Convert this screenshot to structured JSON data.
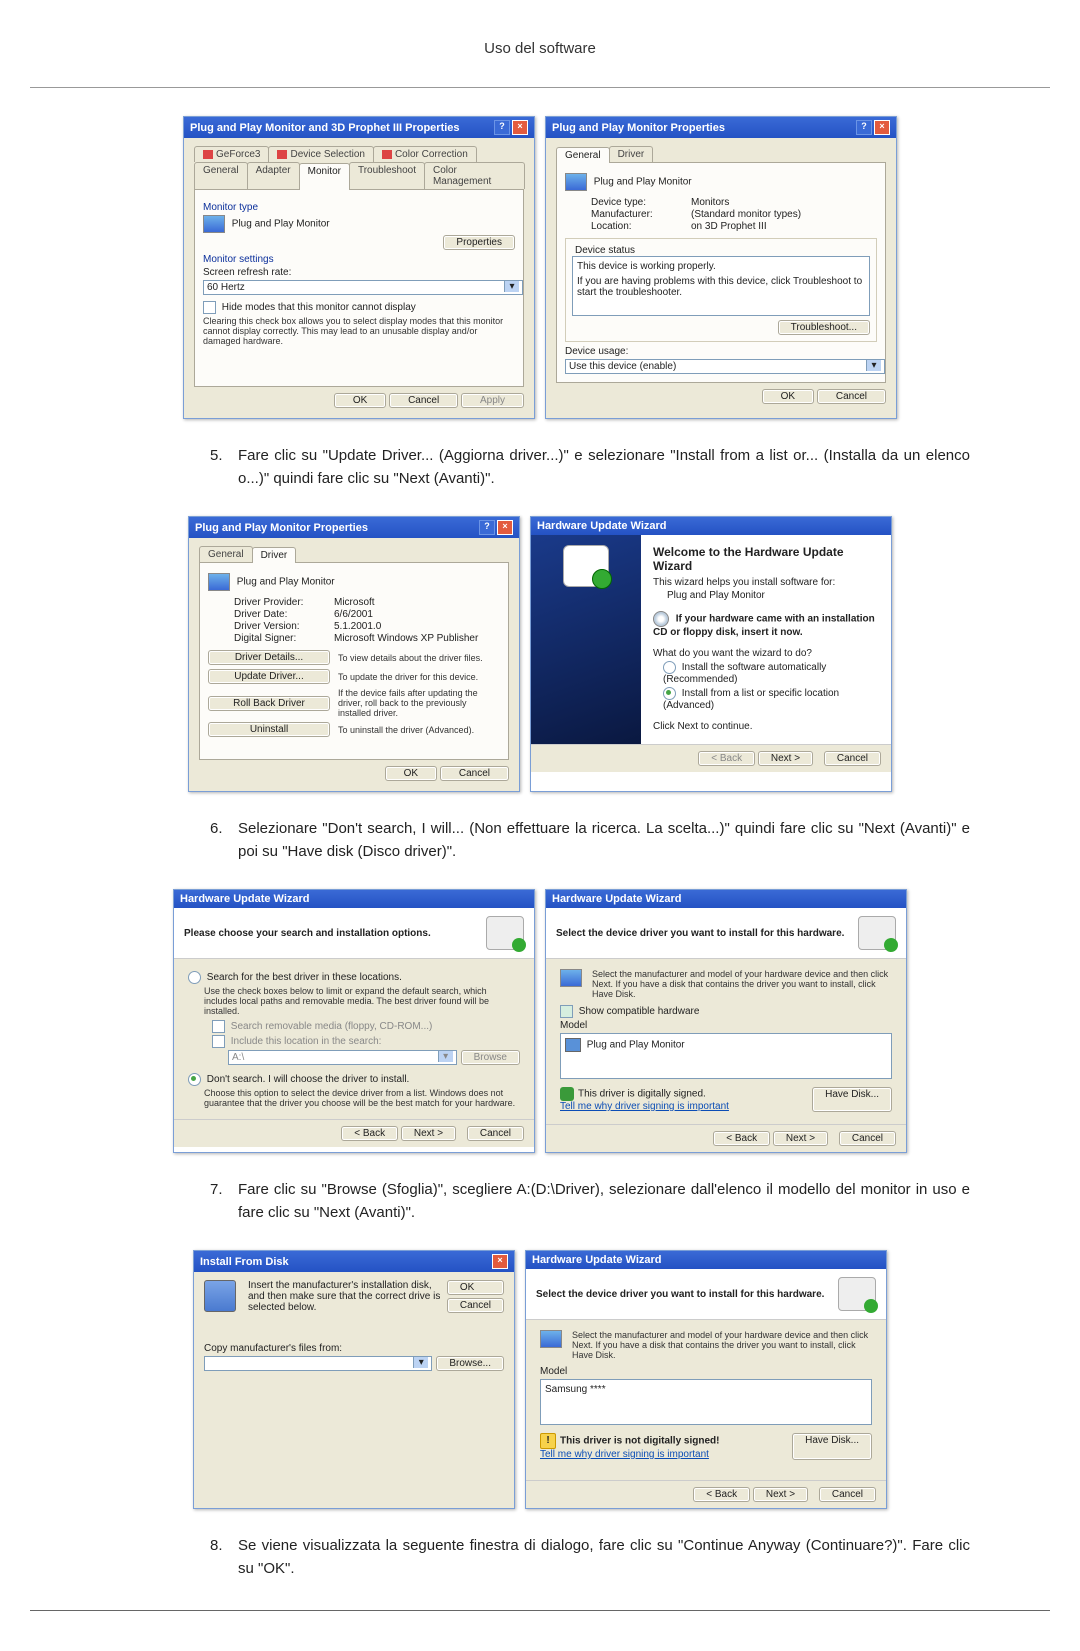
{
  "header": "Uso del software",
  "steps": {
    "s5": {
      "num": "5.",
      "text": "Fare clic su \"Update Driver... (Aggiorna driver...)\" e selezionare \"Install from a list or... (Installa da un elenco o...)\" quindi fare clic su \"Next (Avanti)\"."
    },
    "s6": {
      "num": "6.",
      "text": "Selezionare \"Don't search, I will... (Non effettuare la ricerca. La scelta...)\" quindi fare clic su \"Next (Avanti)\" e poi su \"Have disk (Disco driver)\"."
    },
    "s7": {
      "num": "7.",
      "text": "Fare clic su \"Browse (Sfoglia)\", scegliere A:(D:\\Driver), selezionare dall'elenco il modello del monitor in uso e fare clic su \"Next (Avanti)\"."
    },
    "s8": {
      "num": "8.",
      "text": "Se viene visualizzata la seguente finestra di dialogo, fare clic su \"Continue Anyway (Continuare?)\". Fare clic su \"OK\"."
    }
  },
  "dlg1a": {
    "title": "Plug and Play Monitor and 3D Prophet III Properties",
    "tabs_top": [
      "GeForce3",
      "Device Selection",
      "Color Correction"
    ],
    "tabs_bot": [
      "General",
      "Adapter",
      "Monitor",
      "Troubleshoot",
      "Color Management"
    ],
    "group1": "Monitor type",
    "monitor_name": "Plug and Play Monitor",
    "properties_btn": "Properties",
    "group2": "Monitor settings",
    "refresh_label": "Screen refresh rate:",
    "refresh_value": "60 Hertz",
    "hide_modes": "Hide modes that this monitor cannot display",
    "hide_hint": "Clearing this check box allows you to select display modes that this monitor cannot display correctly. This may lead to an unusable display and/or damaged hardware.",
    "ok": "OK",
    "cancel": "Cancel",
    "apply": "Apply"
  },
  "dlg1b": {
    "title": "Plug and Play Monitor Properties",
    "tabs": [
      "General",
      "Driver"
    ],
    "header": "Plug and Play Monitor",
    "kv": {
      "type": {
        "k": "Device type:",
        "v": "Monitors"
      },
      "mfr": {
        "k": "Manufacturer:",
        "v": "(Standard monitor types)"
      },
      "loc": {
        "k": "Location:",
        "v": "on 3D Prophet III"
      }
    },
    "status_label": "Device status",
    "status_text": "This device is working properly.",
    "status_hint": "If you are having problems with this device, click Troubleshoot to start the troubleshooter.",
    "troubleshoot": "Troubleshoot...",
    "usage_label": "Device usage:",
    "usage_value": "Use this device (enable)",
    "ok": "OK",
    "cancel": "Cancel"
  },
  "dlg2a": {
    "title": "Plug and Play Monitor Properties",
    "tabs": [
      "General",
      "Driver"
    ],
    "header": "Plug and Play Monitor",
    "kv": {
      "provider": {
        "k": "Driver Provider:",
        "v": "Microsoft"
      },
      "date": {
        "k": "Driver Date:",
        "v": "6/6/2001"
      },
      "version": {
        "k": "Driver Version:",
        "v": "5.1.2001.0"
      },
      "signer": {
        "k": "Digital Signer:",
        "v": "Microsoft Windows XP Publisher"
      }
    },
    "btn_details": "Driver Details...",
    "hint_details": "To view details about the driver files.",
    "btn_update": "Update Driver...",
    "hint_update": "To update the driver for this device.",
    "btn_rollback": "Roll Back Driver",
    "hint_rollback": "If the device fails after updating the driver, roll back to the previously installed driver.",
    "btn_uninstall": "Uninstall",
    "hint_uninstall": "To uninstall the driver (Advanced).",
    "ok": "OK",
    "cancel": "Cancel"
  },
  "dlg2b": {
    "title": "Hardware Update Wizard",
    "welcome": "Welcome to the Hardware Update Wizard",
    "intro": "This wizard helps you install software for:",
    "device": "Plug and Play Monitor",
    "cd_hint": "If your hardware came with an installation CD or floppy disk, insert it now.",
    "question": "What do you want the wizard to do?",
    "opt1": "Install the software automatically (Recommended)",
    "opt2": "Install from a list or specific location (Advanced)",
    "continue": "Click Next to continue.",
    "back": "< Back",
    "next": "Next >",
    "cancel": "Cancel"
  },
  "dlg3a": {
    "title": "Hardware Update Wizard",
    "head": "Please choose your search and installation options.",
    "opt1": "Search for the best driver in these locations.",
    "opt1_hint": "Use the check boxes below to limit or expand the default search, which includes local paths and removable media. The best driver found will be installed.",
    "chk1": "Search removable media (floppy, CD-ROM...)",
    "chk2": "Include this location in the search:",
    "path": "A:\\",
    "browse": "Browse",
    "opt2": "Don't search. I will choose the driver to install.",
    "opt2_hint": "Choose this option to select the device driver from a list. Windows does not guarantee that the driver you choose will be the best match for your hardware.",
    "back": "< Back",
    "next": "Next >",
    "cancel": "Cancel"
  },
  "dlg3b": {
    "title": "Hardware Update Wizard",
    "head": "Select the device driver you want to install for this hardware.",
    "hint": "Select the manufacturer and model of your hardware device and then click Next. If you have a disk that contains the driver you want to install, click Have Disk.",
    "show_compat": "Show compatible hardware",
    "model": "Model",
    "model_item": "Plug and Play Monitor",
    "signed": "This driver is digitally signed.",
    "why": "Tell me why driver signing is important",
    "have_disk": "Have Disk...",
    "back": "< Back",
    "next": "Next >",
    "cancel": "Cancel"
  },
  "dlg4a": {
    "title": "Install From Disk",
    "text": "Insert the manufacturer's installation disk, and then make sure that the correct drive is selected below.",
    "ok": "OK",
    "cancel": "Cancel",
    "copy_label": "Copy manufacturer's files from:",
    "path": "",
    "browse": "Browse..."
  },
  "dlg4b": {
    "title": "Hardware Update Wizard",
    "head": "Select the device driver you want to install for this hardware.",
    "hint": "Select the manufacturer and model of your hardware device and then click Next. If you have a disk that contains the driver you want to install, click Have Disk.",
    "model": "Model",
    "model_item": "Samsung ****",
    "not_signed": "This driver is not digitally signed!",
    "why": "Tell me why driver signing is important",
    "have_disk": "Have Disk...",
    "back": "< Back",
    "next": "Next >",
    "cancel": "Cancel"
  }
}
